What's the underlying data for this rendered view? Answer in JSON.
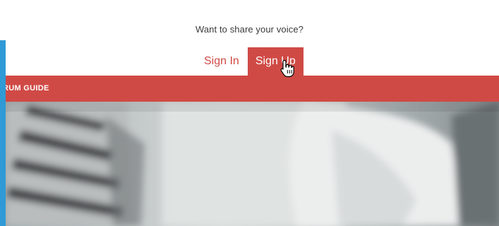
{
  "auth": {
    "prompt": "Want to share your voice?",
    "sign_in_label": "Sign In",
    "sign_up_label": "Sign Up"
  },
  "hero": {
    "section_label": "RUM GUIDE"
  },
  "colors": {
    "brand_red": "#d04a45",
    "accent_blue": "#2f9ad6"
  },
  "icons": {
    "cursor": "hand-pointer-icon"
  }
}
